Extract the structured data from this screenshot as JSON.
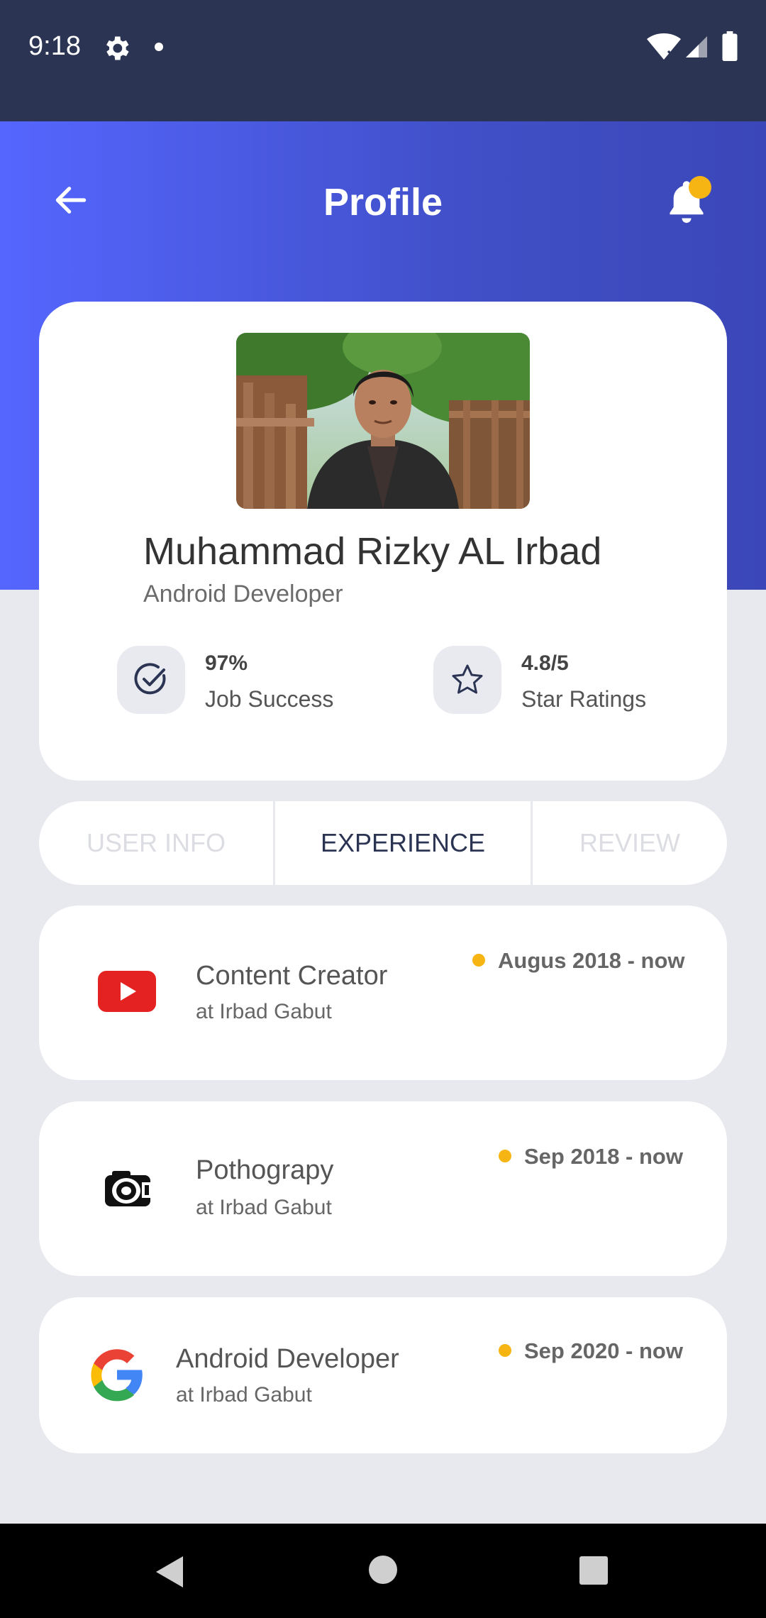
{
  "status_bar": {
    "time": "9:18",
    "icons": [
      "gear-icon",
      "dot-icon",
      "wifi-icon",
      "signal-icon",
      "battery-icon"
    ]
  },
  "header": {
    "title": "Profile",
    "back_icon": "arrow-left-icon",
    "notification_icon": "bell-icon",
    "badge_color": "#f7b514"
  },
  "profile": {
    "name": "Muhammad Rizky AL Irbad",
    "role": "Android Developer",
    "stats": [
      {
        "value": "97%",
        "label": "Job Success",
        "icon": "check-circle-icon"
      },
      {
        "value": "4.8/5",
        "label": "Star Ratings",
        "icon": "star-icon"
      }
    ]
  },
  "tabs": [
    {
      "label": "USER INFO",
      "active": false
    },
    {
      "label": "EXPERIENCE",
      "active": true
    },
    {
      "label": "REVIEW",
      "active": false
    }
  ],
  "experience": [
    {
      "title": "Content Creator",
      "company": "at Irbad Gabut",
      "date": "Augus 2018 - now",
      "icon": "youtube-icon"
    },
    {
      "title": "Pothograpy",
      "company": "at Irbad Gabut",
      "date": "Sep 2018 - now",
      "icon": "camera-icon"
    },
    {
      "title": "Android Developer",
      "company": "at Irbad Gabut",
      "date": "Sep 2020 - now",
      "icon": "google-icon"
    }
  ],
  "colors": {
    "status_bar": "#2b3453",
    "header_gradient_start": "#5566ff",
    "header_gradient_end": "#3b47b8",
    "active_tab": "#2b3453",
    "inactive_tab": "#dcdde3",
    "accent_dot": "#f7b514"
  }
}
